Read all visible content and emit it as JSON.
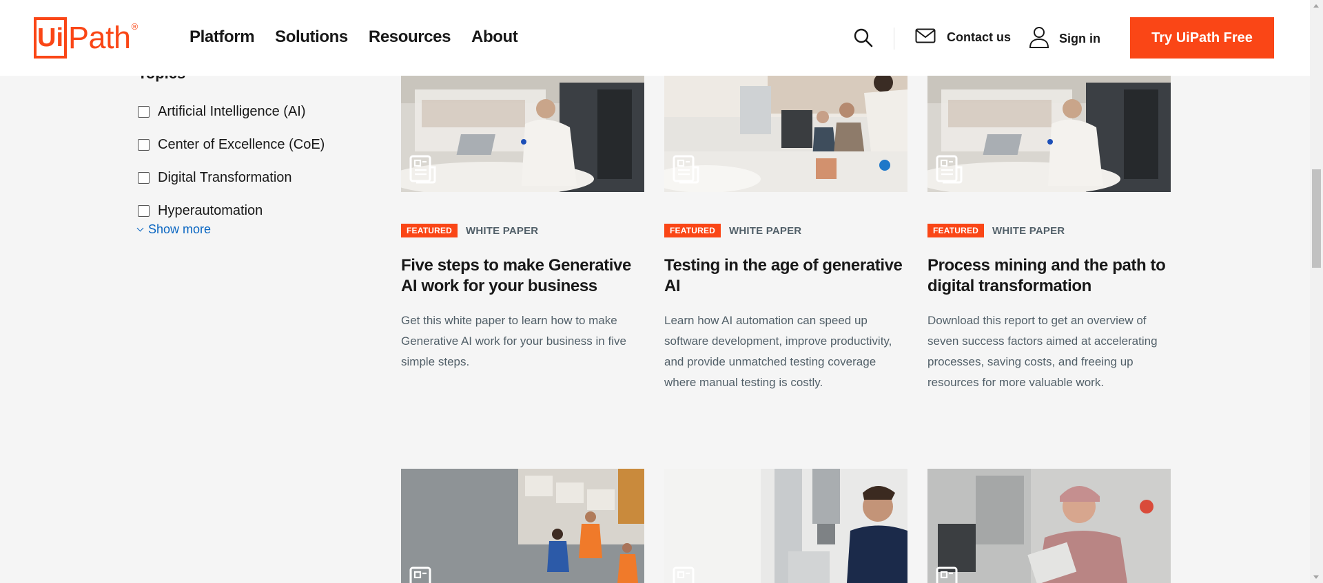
{
  "brand": {
    "logo_box": "Ui",
    "logo_text": "Path",
    "logo_mark": "®"
  },
  "nav": [
    "Platform",
    "Solutions",
    "Resources",
    "About"
  ],
  "header": {
    "contact_label": "Contact us",
    "signin_label": "Sign in",
    "cta_label": "Try UiPath Free",
    "accent_color": "#fa4616"
  },
  "filters": {
    "heading": "Topics",
    "items": [
      "Artificial Intelligence (AI)",
      "Center of Excellence (CoE)",
      "Digital Transformation",
      "Hyperautomation"
    ],
    "show_more": "Show more"
  },
  "cards": [
    {
      "badge": "FEATURED",
      "type": "WHITE PAPER",
      "title": "Five steps to make Generative AI work for your business",
      "description": "Get this white paper to learn how to make Generative AI work for your business in five simple steps.",
      "image": "man-working-on-laptop-in-train",
      "icon": "document-icon"
    },
    {
      "badge": "FEATURED",
      "type": "WHITE PAPER",
      "title": "Testing in the age of generative AI",
      "description": "Learn how AI automation can speed up software development, improve productivity, and provide unmatched testing coverage where manual testing is costly.",
      "image": "call-center-workers-with-headsets",
      "icon": "document-icon"
    },
    {
      "badge": "FEATURED",
      "type": "WHITE PAPER",
      "title": "Process mining and the path to digital transformation",
      "description": "Download this report to get an overview of seven success factors aimed at accelerating processes, saving costs, and freeing up resources for more valuable work.",
      "image": "man-working-on-laptop-in-train",
      "icon": "document-icon"
    },
    {
      "image": "warehouse-workers-with-tablet",
      "icon": "document-icon"
    },
    {
      "image": "engineer-at-industrial-machine",
      "icon": "document-icon"
    },
    {
      "image": "lab-worker-with-tablet",
      "icon": "document-icon"
    }
  ]
}
